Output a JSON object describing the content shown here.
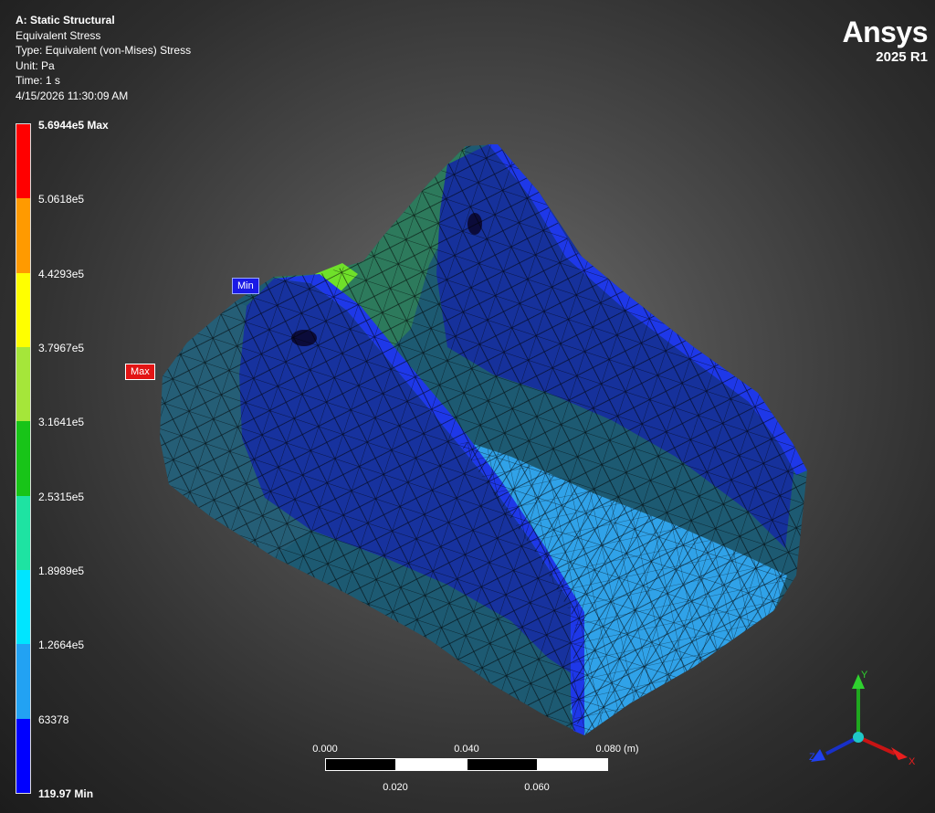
{
  "header": {
    "title": "A: Static Structural",
    "result": "Equivalent Stress",
    "type": "Type: Equivalent (von-Mises) Stress",
    "unit": "Unit: Pa",
    "time": "Time: 1 s",
    "timestamp": "4/15/2026 11:30:09 AM"
  },
  "brand": {
    "name": "Ansys",
    "version": "2025 R1"
  },
  "legend": {
    "colors": [
      "#ff0000",
      "#ff9a00",
      "#ffff00",
      "#a5e63a",
      "#18c418",
      "#1ee3a2",
      "#00e5ff",
      "#22a2f3",
      "#0000ff"
    ],
    "ticks": [
      "5.6944e5 Max",
      "5.0618e5",
      "4.4293e5",
      "3.7967e5",
      "3.1641e5",
      "2.5315e5",
      "1.8989e5",
      "1.2664e5",
      "63378",
      "119.97 Min"
    ]
  },
  "probes": {
    "max_label": "Max",
    "min_label": "Min"
  },
  "scale_bar": {
    "top_labels": [
      "0.000",
      "0.040",
      "0.080 (m)"
    ],
    "bottom_labels": [
      "0.020",
      "0.060"
    ]
  },
  "triad": {
    "x": "X",
    "y": "Y",
    "z": "Z"
  }
}
